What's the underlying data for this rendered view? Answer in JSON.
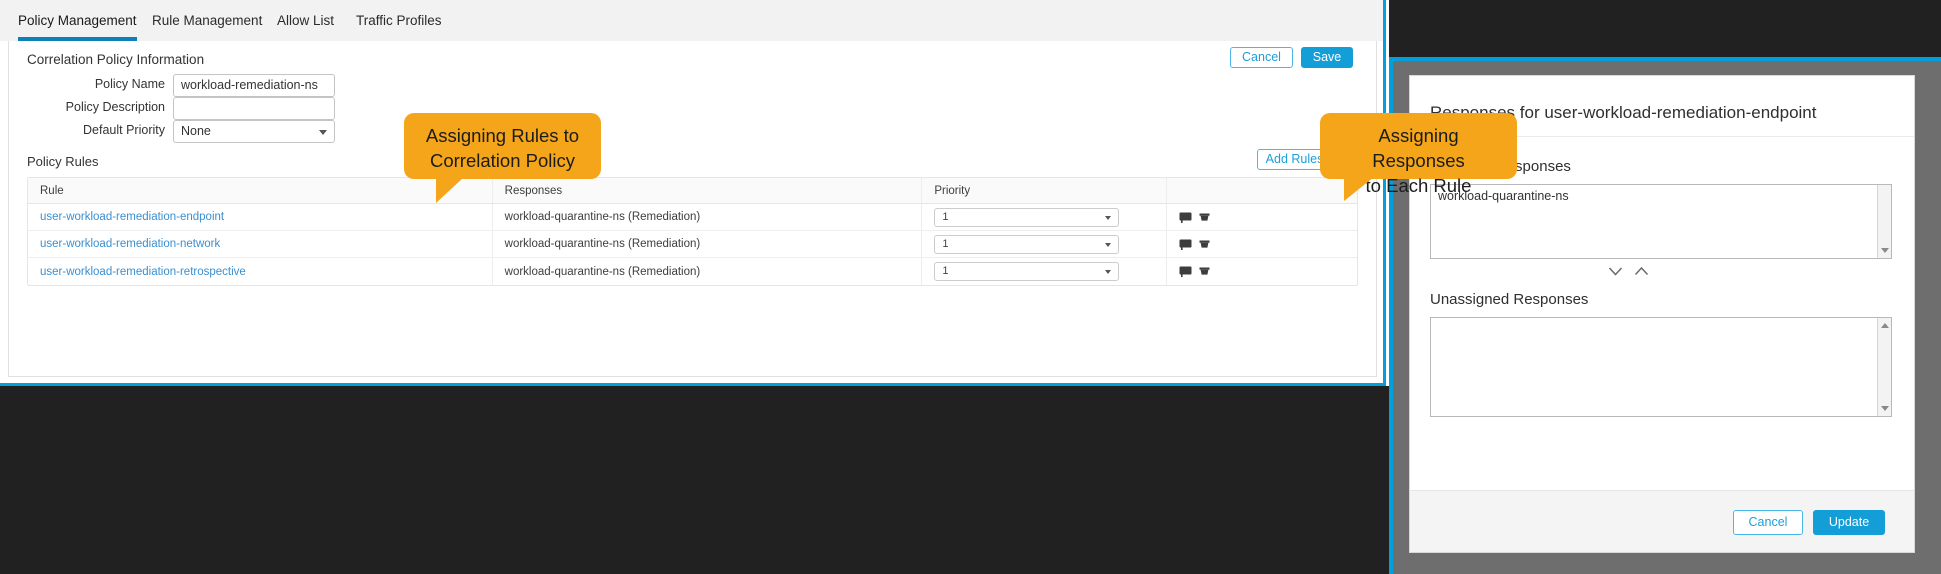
{
  "colors": {
    "accent": "#00a0dd",
    "primary_button": "#149ed8",
    "link": "#3a8fd0",
    "callout": "#f4a519",
    "dark_backdrop": "#212121",
    "modal_backdrop": "#6e6e6e"
  },
  "left_panel": {
    "tabs": [
      {
        "label": "Policy Management",
        "active": true
      },
      {
        "label": "Rule Management",
        "active": false
      },
      {
        "label": "Allow List",
        "active": false
      },
      {
        "label": "Traffic Profiles",
        "active": false
      }
    ],
    "header_buttons": {
      "cancel_label": "Cancel",
      "save_label": "Save"
    },
    "correlation_section": {
      "title": "Correlation Policy Information",
      "fields": [
        {
          "label": "Policy Name",
          "value": "workload-remediation-ns",
          "placeholder": "",
          "type": "text"
        },
        {
          "label": "Policy Description",
          "value": "",
          "placeholder": "",
          "type": "text"
        },
        {
          "label": "Default Priority",
          "value": "None",
          "placeholder": "",
          "type": "select"
        }
      ]
    },
    "policy_rules": {
      "title": "Policy Rules",
      "add_rules_label": "Add Rules",
      "columns": [
        "Rule",
        "Responses",
        "Priority",
        ""
      ],
      "rows": [
        {
          "rule": "user-workload-remediation-endpoint",
          "response": "workload-quarantine-ns (Remediation)",
          "priority": "1"
        },
        {
          "rule": "user-workload-remediation-network",
          "response": "workload-quarantine-ns (Remediation)",
          "priority": "1"
        },
        {
          "rule": "user-workload-remediation-retrospective",
          "response": "workload-quarantine-ns (Remediation)",
          "priority": "1"
        }
      ],
      "row_icons": [
        "comment-icon",
        "trash-icon"
      ]
    }
  },
  "right_panel": {
    "dialog": {
      "title": "Responses for user-workload-remediation-endpoint",
      "assigned_label": "Assigned Responses",
      "assigned_items": [
        "workload-quarantine-ns"
      ],
      "unassigned_label": "Unassigned Responses",
      "unassigned_items": [],
      "move_icons": [
        "chevron-down-icon",
        "chevron-up-icon"
      ],
      "footer": {
        "cancel_label": "Cancel",
        "update_label": "Update"
      }
    }
  },
  "callouts": {
    "left": {
      "line1": "Assigning Rules to",
      "line2": "Correlation Policy"
    },
    "right": {
      "line1": "Assigning Responses",
      "line2": "to Each Rule"
    }
  }
}
